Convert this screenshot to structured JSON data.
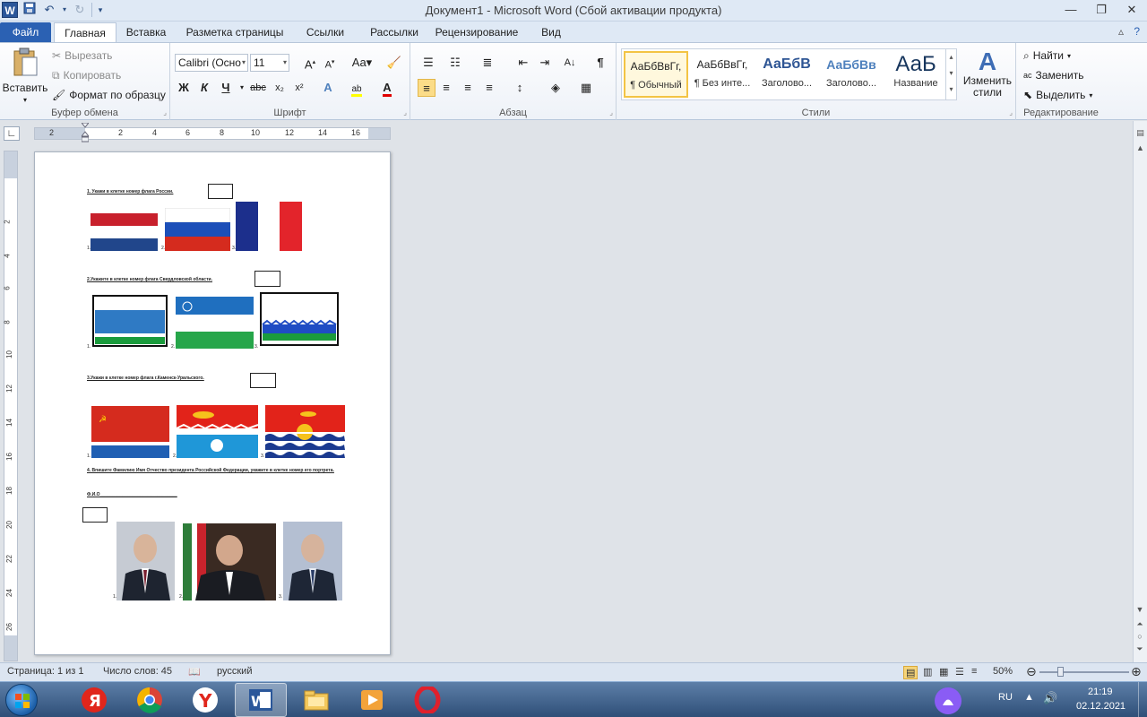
{
  "window": {
    "title": "Документ1  -  Microsoft Word (Сбой активации продукта)",
    "app_letter": "W"
  },
  "tabs": {
    "file": "Файл",
    "items": [
      "Главная",
      "Вставка",
      "Разметка страницы",
      "Ссылки",
      "Рассылки",
      "Рецензирование",
      "Вид"
    ],
    "active_index": 0
  },
  "ribbon": {
    "clipboard": {
      "label": "Буфер обмена",
      "paste": "Вставить",
      "cut": "Вырезать",
      "copy": "Копировать",
      "format_painter": "Формат по образцу"
    },
    "font": {
      "label": "Шрифт",
      "family": "Calibri (Осно",
      "size": "11"
    },
    "paragraph": {
      "label": "Абзац"
    },
    "styles": {
      "label": "Стили",
      "items": [
        {
          "sample": "АаБбВвГг,",
          "name": "¶ Обычный",
          "color": "#000000"
        },
        {
          "sample": "АаБбВвГг,",
          "name": "¶ Без инте...",
          "color": "#000000"
        },
        {
          "sample": "АаБбВ",
          "name": "Заголово...",
          "color": "#2e5594"
        },
        {
          "sample": "АаБбВв",
          "name": "Заголово...",
          "color": "#4f81bd"
        },
        {
          "sample": "АаБ",
          "name": "Название",
          "color": "#17365d"
        }
      ],
      "change": "Изменить стили"
    },
    "editing": {
      "label": "Редактирование",
      "find": "Найти",
      "replace": "Заменить",
      "select": "Выделить"
    }
  },
  "ruler": {
    "h_numbers": [
      "2",
      "2",
      "4",
      "6",
      "8",
      "10",
      "12",
      "14",
      "16"
    ],
    "v_numbers": [
      "2",
      "4",
      "6",
      "8",
      "10",
      "12",
      "14",
      "16",
      "18",
      "20",
      "22",
      "24",
      "26"
    ]
  },
  "document": {
    "q1": "1. Укажи  в клетке номер флага России.",
    "q2": "2.Укажите  в клетке номер флага Свердловской области.",
    "q3": "3.Укажи в клетке номер флага г.Каменск-Уральского.",
    "q4": "4. Впишите Фамилию Имя Отчество президента Российской Федерации, укажите  в клетке номер его портрета.",
    "fio": "Ф.И.О_______________________________",
    "indices": [
      "1.",
      "2.",
      "3."
    ]
  },
  "status": {
    "page": "Страница: 1 из 1",
    "words": "Число слов: 45",
    "language": "русский",
    "zoom": "50%"
  },
  "taskbar": {
    "lang": "RU",
    "time": "21:19",
    "date": "02.12.2021"
  }
}
